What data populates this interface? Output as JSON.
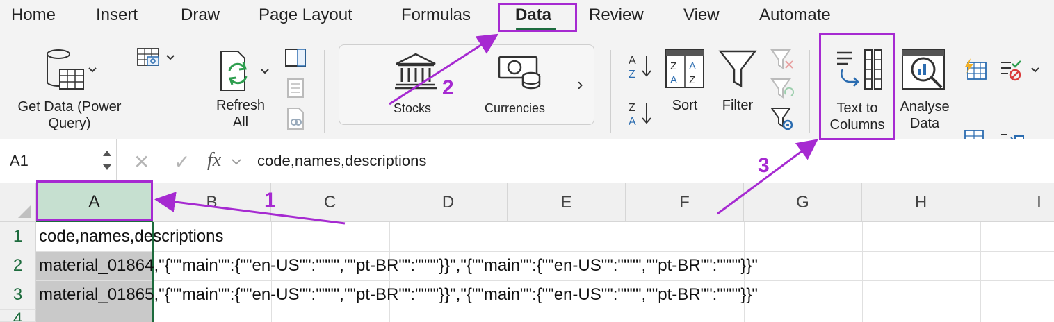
{
  "tabs": [
    "Home",
    "Insert",
    "Draw",
    "Page Layout",
    "Formulas",
    "Data",
    "Review",
    "View",
    "Automate"
  ],
  "active_tab": "Data",
  "ribbon": {
    "get_data": "Get Data (Power\nQuery)",
    "refresh_all": "Refresh\nAll",
    "stocks": "Stocks",
    "currencies": "Currencies",
    "sort": "Sort",
    "filter": "Filter",
    "text_to_columns": "Text to\nColumns",
    "analyse_data": "Analyse\nData",
    "more_chevron": "›"
  },
  "formula_bar": {
    "name_box": "A1",
    "cancel": "✕",
    "enter": "✓",
    "fx": "fx",
    "value": "code,names,descriptions"
  },
  "grid": {
    "columns": [
      "A",
      "B",
      "C",
      "D",
      "E",
      "F",
      "G",
      "H",
      "I"
    ],
    "rows": [
      "1",
      "2",
      "3",
      "4"
    ],
    "cells": {
      "A1": "code,names,descriptions",
      "A2": "material_01864,\"{\"\"main\"\":{\"\"en-US\"\":\"\"\"\",\"\"pt-BR\"\":\"\"\"\"}}\",\"{\"\"main\"\":{\"\"en-US\"\":\"\"\"\",\"\"pt-BR\"\":\"\"\"\"}}\"",
      "A3": "material_01865,\"{\"\"main\"\":{\"\"en-US\"\":\"\"\"\",\"\"pt-BR\"\":\"\"\"\"}}\",\"{\"\"main\"\":{\"\"en-US\"\":\"\"\"\",\"\"pt-BR\"\":\"\"\"\"}}\""
    }
  },
  "annotations": [
    "1",
    "2",
    "3"
  ],
  "colors": {
    "annotation": "#a62ad1",
    "excel_green": "#1d6b3d",
    "selected_header": "#c6e0d0"
  }
}
